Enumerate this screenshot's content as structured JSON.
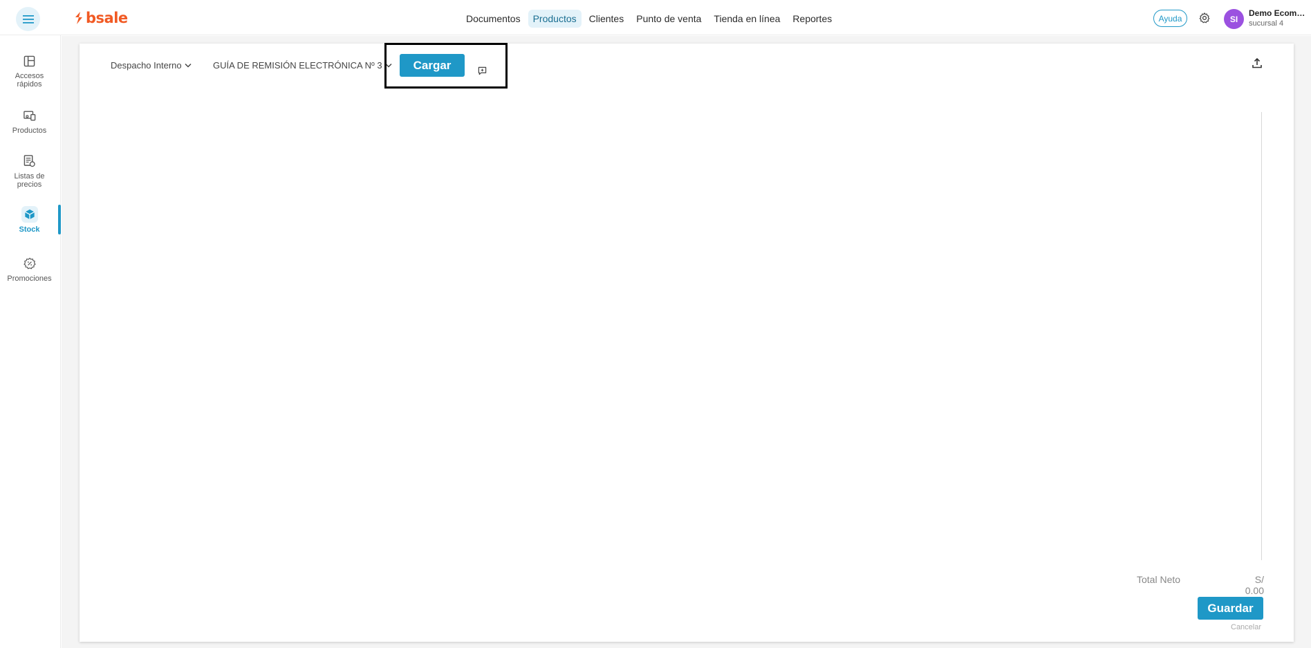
{
  "brand": {
    "name": "bsale",
    "color": "#f15a24"
  },
  "colors": {
    "accent": "#1f98c7",
    "avatar": "#9b51e0"
  },
  "topnav": {
    "items": [
      {
        "label": "Documentos",
        "active": false
      },
      {
        "label": "Productos",
        "active": true
      },
      {
        "label": "Clientes",
        "active": false
      },
      {
        "label": "Punto de venta",
        "active": false
      },
      {
        "label": "Tienda en línea",
        "active": false
      },
      {
        "label": "Reportes",
        "active": false
      }
    ]
  },
  "header": {
    "help_label": "Ayuda",
    "avatar_initials": "SI",
    "user_name": "Demo Ecomm...",
    "user_branch": "sucursal 4"
  },
  "sidebar": {
    "items": [
      {
        "label_line1": "Accesos",
        "label_line2": "rápidos",
        "icon": "layout-icon",
        "active": false
      },
      {
        "label_line1": "Productos",
        "label_line2": "",
        "icon": "products-icon",
        "active": false
      },
      {
        "label_line1": "Listas de",
        "label_line2": "precios",
        "icon": "price-list-icon",
        "active": false
      },
      {
        "label_line1": "Stock",
        "label_line2": "",
        "icon": "box-icon",
        "active": true
      },
      {
        "label_line1": "Promociones",
        "label_line2": "",
        "icon": "discount-icon",
        "active": false
      }
    ]
  },
  "document": {
    "type_label": "Despacho Interno",
    "number_label": "GUÍA DE REMISIÓN ELECTRÓNICA Nº 3",
    "load_button": "Cargar",
    "total_label": "Total Neto",
    "total_value": "S/ 0.00",
    "save_button": "Guardar",
    "cancel_link": "Cancelar"
  }
}
